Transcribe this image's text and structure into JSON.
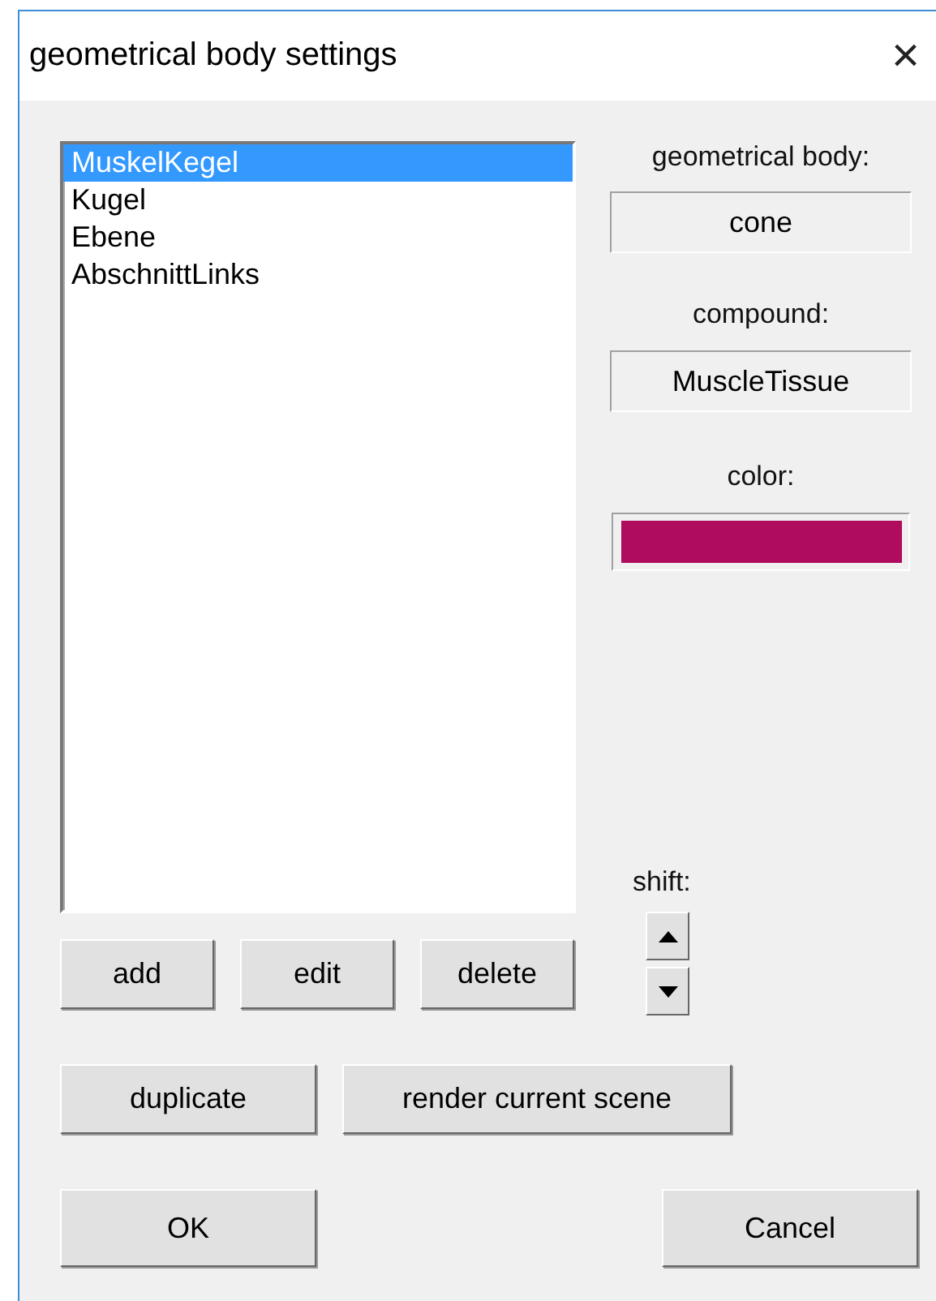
{
  "window": {
    "title": "geometrical body settings",
    "close": "×"
  },
  "bodies": [
    {
      "label": "MuskelKegel",
      "selected": true
    },
    {
      "label": "Kugel",
      "selected": false
    },
    {
      "label": "Ebene",
      "selected": false
    },
    {
      "label": "AbschnittLinks",
      "selected": false
    }
  ],
  "properties": {
    "body_label": "geometrical body:",
    "body_value": "cone",
    "compound_label": "compound:",
    "compound_value": "MuscleTissue",
    "color_label": "color:",
    "color": "#b00c5e"
  },
  "shift": {
    "label": "shift:"
  },
  "list_buttons": [
    "add",
    "edit",
    "delete"
  ],
  "action_buttons": [
    "duplicate",
    "render current scene"
  ],
  "dialog_buttons": [
    "OK",
    "Cancel"
  ]
}
